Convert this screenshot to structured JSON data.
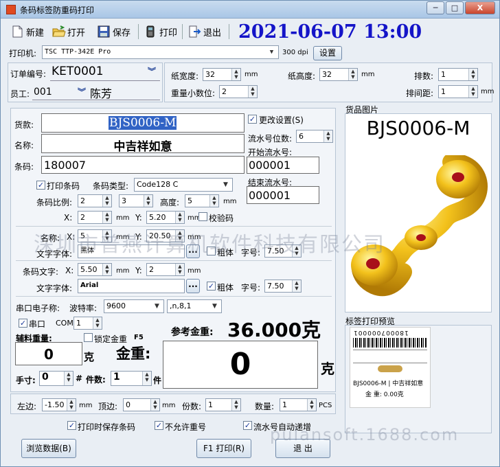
{
  "window": {
    "title": "条码标签防重码打印",
    "minimize": "─",
    "maximize": "□",
    "close": "X"
  },
  "toolbar": {
    "new": "新建",
    "open": "打开",
    "save": "保存",
    "print": "打印",
    "exit": "退出"
  },
  "datetime": "2021-06-07 13:00",
  "printer": {
    "label": "打印机:",
    "value": "TSC TTP-342E Pro",
    "dpi": "300 dpi",
    "settings": "设置"
  },
  "order": {
    "label": "订单编号:",
    "value": "KET0001"
  },
  "employee": {
    "label": "员工:",
    "id": "001",
    "name": "陈芳"
  },
  "paper": {
    "width_label": "纸宽度:",
    "width": "32",
    "height_label": "纸高度:",
    "height": "32",
    "unit": "mm",
    "decimals_label": "重量小数位:",
    "decimals": "2",
    "rows_label": "排数:",
    "rows": "1",
    "spacing_label": "排间距:",
    "spacing": "1"
  },
  "product": {
    "item_label": "货款:",
    "item": "BJS0006-M",
    "name_label": "名称:",
    "name": "中吉祥如意",
    "barcode_label": "条码:",
    "barcode": "180007"
  },
  "change": {
    "label": "更改设置(S)",
    "digits_label": "流水号位数:",
    "digits": "6",
    "start_label": "开始流水号:",
    "start": "000001",
    "end_label": "结束流水号:",
    "end": "000001"
  },
  "barcode": {
    "print_label": "打印条码",
    "type_label": "条码类型:",
    "type": "Code128 C",
    "ratio_label": "条码比例:",
    "ratio1": "2",
    "ratio2": "3",
    "height_label": "高度:",
    "height": "5",
    "x_label": "X:",
    "x": "2",
    "y_label": "Y:",
    "y": "5.20",
    "unit": "mm",
    "check_label": "校验码"
  },
  "name_text": {
    "label": "名称:",
    "x_label": "X:",
    "x": "5",
    "y_label": "Y:",
    "y": "20.50",
    "font_label": "文字字体:",
    "font": "黑体",
    "browse": "...",
    "bold_label": "粗体",
    "size_label": "字号:",
    "size": "7.50",
    "unit": "mm"
  },
  "barcode_text": {
    "label": "条码文字:",
    "x_label": "X:",
    "x": "5.50",
    "y_label": "Y:",
    "y": "2",
    "font_label": "文字字体:",
    "font": "Arial",
    "browse": "...",
    "bold_label": "粗体",
    "size_label": "字号:",
    "size": "7.50",
    "unit": "mm"
  },
  "scale": {
    "label": "串口电子称:",
    "baud_label": "波特率:",
    "baud": "9600",
    "params": ",n,8,1",
    "serial_label": "串口",
    "com_label": "COM",
    "com": "1"
  },
  "weights": {
    "aux_label": "辅料重量:",
    "aux": "0",
    "unit_k": "克",
    "lock_label": "锁定金重",
    "lock_key": "F5",
    "ref_label": "参考金重:",
    "ref_value": "36.000克",
    "gold_label": "金重:",
    "gold": "0",
    "gold_unit": "克"
  },
  "hand": {
    "label": "手寸:",
    "value": "0",
    "hash": "#",
    "pieces_label": "件数:",
    "pieces": "1",
    "piece_unit": "件"
  },
  "margins": {
    "left_label": "左边:",
    "left": "-1.50",
    "top_label": "顶边:",
    "top": "0",
    "copies_label": "份数:",
    "copies": "1",
    "qty_label": "数量:",
    "qty": "1",
    "unit": "mm",
    "pcs": "PCS"
  },
  "options": {
    "save_barcode": "打印时保存条码",
    "no_dup": "不允许重号",
    "auto_inc": "流水号自动递增"
  },
  "footer": {
    "browse": "浏览数据(B)",
    "print": "F1 打印(R)",
    "exit": "退 出"
  },
  "image_panel": {
    "title": "货品图片",
    "code": "BJS0006-M"
  },
  "preview": {
    "title": "标签打印预览",
    "barcode_num": "180007000001",
    "line": "BJS0006-M | 中吉祥如意",
    "weight": "金  重: 0.00克"
  },
  "watermarks": {
    "center": "深圳市普燕计算机软件科技有限公司",
    "bottom": "pulansoft.1688.com"
  },
  "colors": {
    "accent": "#1414c8",
    "selection": "#3163c5"
  }
}
